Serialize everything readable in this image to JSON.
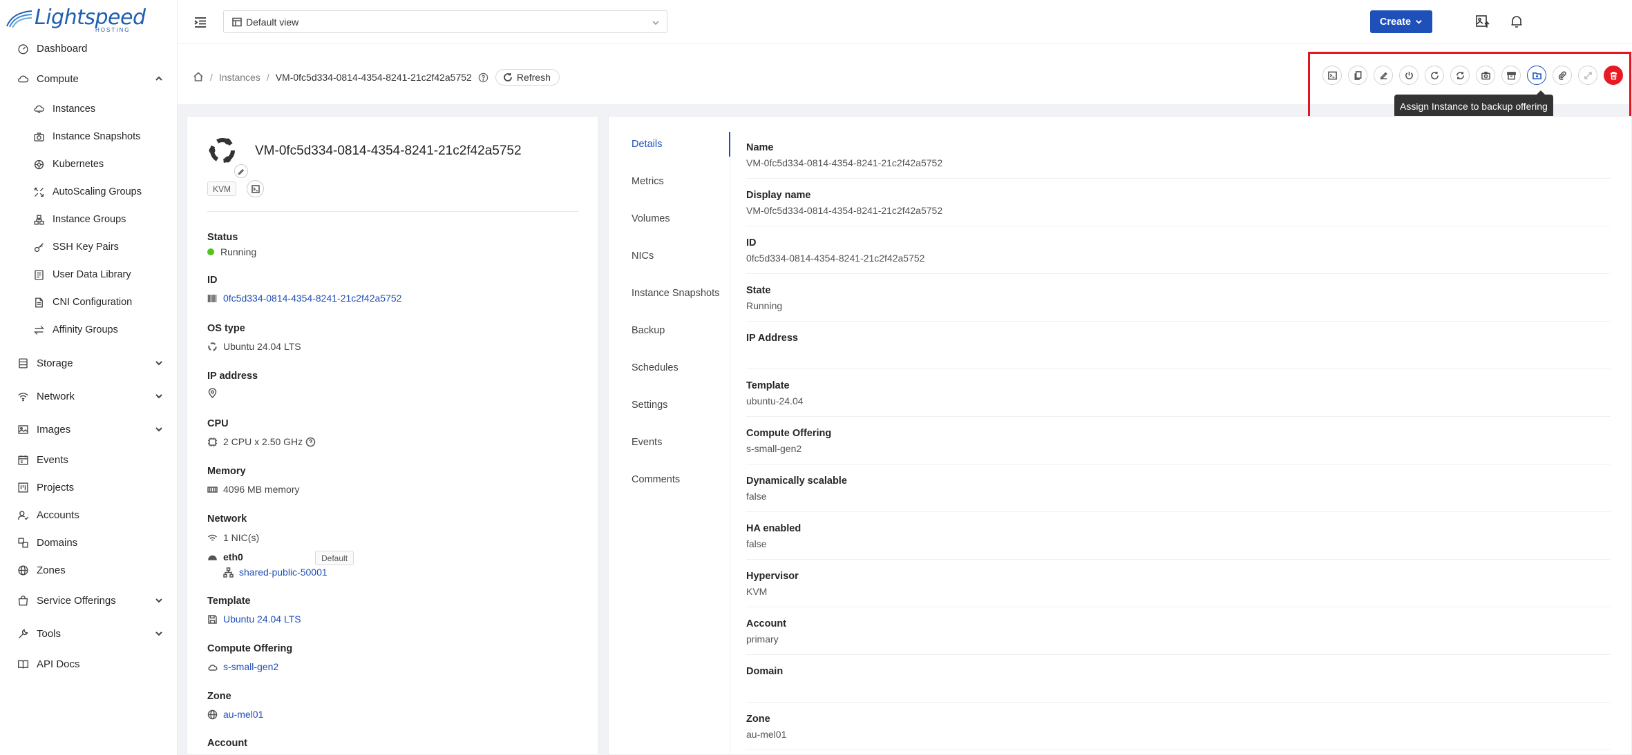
{
  "brand": {
    "name": "Lightspeed",
    "sub": "HOSTING"
  },
  "sidebar": {
    "items": [
      {
        "label": "Dashboard",
        "icon": "dashboard-icon",
        "level": "top"
      },
      {
        "label": "Compute",
        "icon": "cloud-icon",
        "level": "top",
        "expanded": true
      },
      {
        "label": "Instances",
        "icon": "cloud-server-icon",
        "level": "sub"
      },
      {
        "label": "Instance Snapshots",
        "icon": "camera-icon",
        "level": "sub"
      },
      {
        "label": "Kubernetes",
        "icon": "kubernetes-icon",
        "level": "sub"
      },
      {
        "label": "AutoScaling Groups",
        "icon": "expand-icon",
        "level": "sub"
      },
      {
        "label": "Instance Groups",
        "icon": "cluster-icon",
        "level": "sub"
      },
      {
        "label": "SSH Key Pairs",
        "icon": "key-icon",
        "level": "sub"
      },
      {
        "label": "User Data Library",
        "icon": "solution-icon",
        "level": "sub"
      },
      {
        "label": "CNI Configuration",
        "icon": "file-icon",
        "level": "sub"
      },
      {
        "label": "Affinity Groups",
        "icon": "swap-icon",
        "level": "sub"
      },
      {
        "label": "Storage",
        "icon": "database-icon",
        "level": "top",
        "expanded": false
      },
      {
        "label": "Network",
        "icon": "wifi-icon",
        "level": "top",
        "expanded": false
      },
      {
        "label": "Images",
        "icon": "picture-icon",
        "level": "top",
        "expanded": false
      },
      {
        "label": "Events",
        "icon": "schedule-icon",
        "level": "top"
      },
      {
        "label": "Projects",
        "icon": "project-icon",
        "level": "top"
      },
      {
        "label": "Accounts",
        "icon": "team-icon",
        "level": "top"
      },
      {
        "label": "Domains",
        "icon": "block-icon",
        "level": "top"
      },
      {
        "label": "Zones",
        "icon": "global-icon",
        "level": "top"
      },
      {
        "label": "Service Offerings",
        "icon": "shopping-icon",
        "level": "top",
        "expanded": false
      },
      {
        "label": "Tools",
        "icon": "tool-icon",
        "level": "top",
        "expanded": false
      },
      {
        "label": "API Docs",
        "icon": "read-icon",
        "level": "top"
      }
    ]
  },
  "topbar": {
    "view_select": "Default view",
    "create_label": "Create"
  },
  "breadcrumb": {
    "section": "Instances",
    "current": "VM-0fc5d334-0814-4354-8241-21c2f42a5752",
    "refresh_label": "Refresh"
  },
  "actions": {
    "items": [
      {
        "name": "view-console",
        "icon": "code-icon"
      },
      {
        "name": "copy-console-url",
        "icon": "copy-icon"
      },
      {
        "name": "edit",
        "icon": "edit-icon"
      },
      {
        "name": "stop",
        "icon": "poweroff-icon"
      },
      {
        "name": "reboot",
        "icon": "reload-icon"
      },
      {
        "name": "reinstall",
        "icon": "sync-icon"
      },
      {
        "name": "snapshot",
        "icon": "camera-icon"
      },
      {
        "name": "backup",
        "icon": "box-icon"
      },
      {
        "name": "assign-backup-offering",
        "icon": "folder-add-icon",
        "state": "active"
      },
      {
        "name": "attach-iso",
        "icon": "paperclip-icon"
      },
      {
        "name": "scale",
        "icon": "arrows-alt-icon",
        "state": "disabled"
      },
      {
        "name": "destroy",
        "icon": "delete-icon",
        "state": "danger"
      }
    ],
    "tooltip": "Assign Instance to backup offering",
    "highlight_color": "#e0151f"
  },
  "instance": {
    "title": "VM-0fc5d334-0814-4354-8241-21c2f42a5752",
    "hypervisor_tag": "KVM",
    "status_label": "Status",
    "status": "Running",
    "id_label": "ID",
    "id": "0fc5d334-0814-4354-8241-21c2f42a5752",
    "os_label": "OS type",
    "os": "Ubuntu 24.04 LTS",
    "ip_label": "IP address",
    "cpu_label": "CPU",
    "cpu": "2 CPU x 2.50 GHz",
    "memory_label": "Memory",
    "memory": "4096 MB memory",
    "network_label": "Network",
    "nics": "1 NIC(s)",
    "nic_name": "eth0",
    "nic_tag": "Default",
    "nic_network": "shared-public-50001",
    "template_label": "Template",
    "template": "Ubuntu 24.04 LTS",
    "offering_label": "Compute Offering",
    "offering": "s-small-gen2",
    "zone_label": "Zone",
    "zone": "au-mel01",
    "account_label": "Account"
  },
  "tabs": [
    "Details",
    "Metrics",
    "Volumes",
    "NICs",
    "Instance Snapshots",
    "Backup",
    "Schedules",
    "Settings",
    "Events",
    "Comments"
  ],
  "details": [
    {
      "label": "Name",
      "value": "VM-0fc5d334-0814-4354-8241-21c2f42a5752"
    },
    {
      "label": "Display name",
      "value": "VM-0fc5d334-0814-4354-8241-21c2f42a5752"
    },
    {
      "label": "ID",
      "value": "0fc5d334-0814-4354-8241-21c2f42a5752"
    },
    {
      "label": "State",
      "value": "Running"
    },
    {
      "label": "IP Address",
      "value": ""
    },
    {
      "label": "Template",
      "value": "ubuntu-24.04"
    },
    {
      "label": "Compute Offering",
      "value": "s-small-gen2"
    },
    {
      "label": "Dynamically scalable",
      "value": "false"
    },
    {
      "label": "HA enabled",
      "value": "false"
    },
    {
      "label": "Hypervisor",
      "value": "KVM"
    },
    {
      "label": "Account",
      "value": "primary"
    },
    {
      "label": "Domain",
      "value": ""
    },
    {
      "label": "Zone",
      "value": "au-mel01"
    }
  ],
  "colors": {
    "accent": "#1f4fb8",
    "danger": "#e81a24",
    "status_running": "#52c41a"
  }
}
